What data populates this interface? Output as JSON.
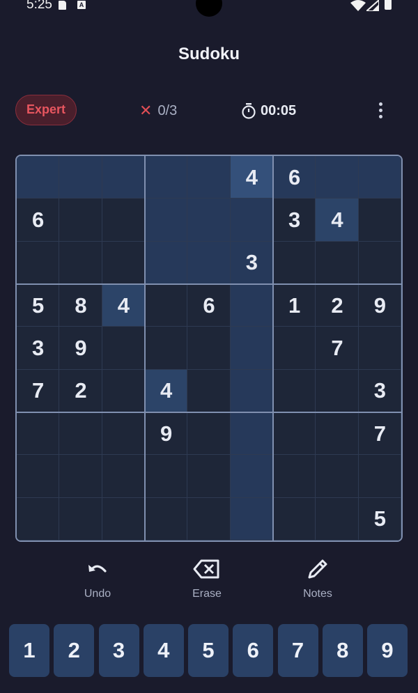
{
  "status_bar": {
    "time": "5:25",
    "sd_icon": "sd-card-icon",
    "a_icon_letter": "A"
  },
  "header": {
    "title": "Sudoku"
  },
  "info": {
    "difficulty": "Expert",
    "mistakes": "0/3",
    "timer": "00:05"
  },
  "board": {
    "colors": {
      "base": "#1e2638",
      "highlight": "#26395a",
      "selected": "#34507a",
      "same_number": "#2c4468"
    },
    "selected_cell": [
      0,
      5
    ],
    "grid": [
      [
        "",
        "",
        "",
        "",
        "",
        "4",
        "6",
        "",
        ""
      ],
      [
        "6",
        "",
        "",
        "",
        "",
        "",
        "3",
        "4",
        ""
      ],
      [
        "",
        "",
        "",
        "",
        "",
        "3",
        "",
        "",
        ""
      ],
      [
        "5",
        "8",
        "4",
        "",
        "6",
        "",
        "1",
        "2",
        "9"
      ],
      [
        "3",
        "9",
        "",
        "",
        "",
        "",
        "",
        "7",
        ""
      ],
      [
        "7",
        "2",
        "",
        "4",
        "",
        "",
        "",
        "",
        "3"
      ],
      [
        "",
        "",
        "",
        "9",
        "",
        "",
        "",
        "",
        "7"
      ],
      [
        "",
        "",
        "",
        "",
        "",
        "",
        "",
        "",
        ""
      ],
      [
        "",
        "",
        "",
        "",
        "",
        "",
        "",
        "",
        "5"
      ]
    ]
  },
  "actions": {
    "undo": "Undo",
    "erase": "Erase",
    "notes": "Notes"
  },
  "numpad": [
    "1",
    "2",
    "3",
    "4",
    "5",
    "6",
    "7",
    "8",
    "9"
  ]
}
